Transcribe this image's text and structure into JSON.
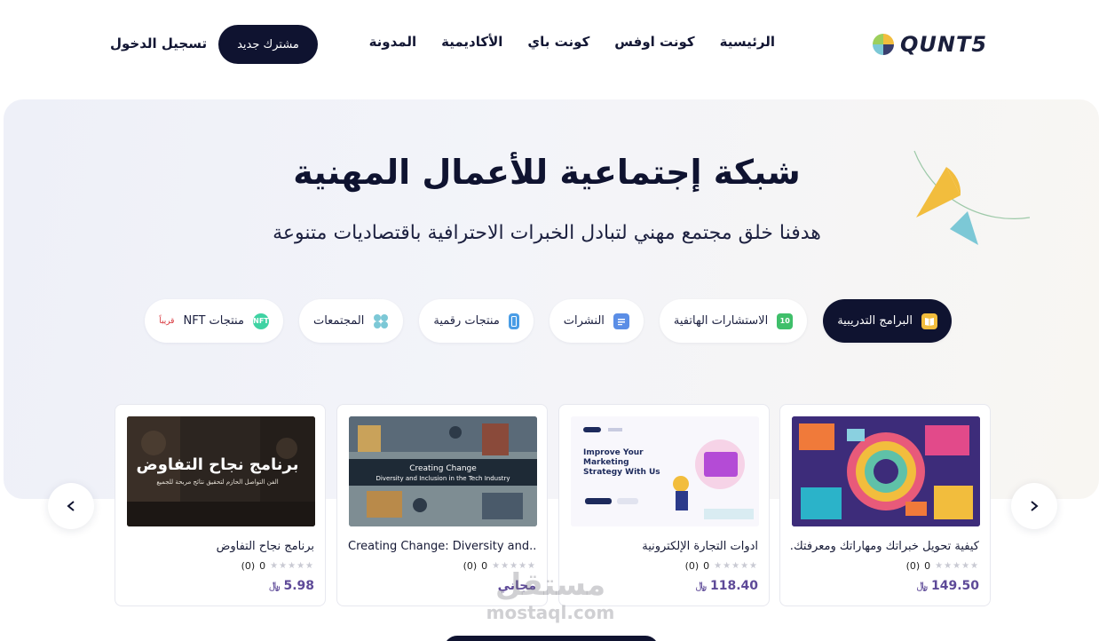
{
  "header": {
    "logo_text": "QUNT5",
    "nav": [
      "الرئيسية",
      "كونت اوفس",
      "كونت باي",
      "الأكاديمية",
      "المدونة"
    ],
    "register_button": "مشترك جديد",
    "login_link": "تسجيل الدخول"
  },
  "hero": {
    "title": "شبكة إجتماعية للأعمال المهنية",
    "subtitle": "هدفنا خلق مجتمع مهني لتبادل الخبرات الاحترافية باقتصاديات متنوعة"
  },
  "categories": [
    {
      "label": "البرامج التدريبية",
      "icon": "book-icon",
      "active": true
    },
    {
      "label": "الاستشارات الهاتفية",
      "icon": "calendar-icon",
      "active": false
    },
    {
      "label": "النشرات",
      "icon": "newsletter-icon",
      "active": false
    },
    {
      "label": "منتجات رقمية",
      "icon": "phone-icon",
      "active": false
    },
    {
      "label": "المجتمعات",
      "icon": "community-icon",
      "active": false
    },
    {
      "label": "منتجات NFT",
      "icon": "nft-icon",
      "active": false,
      "badge": "قريباً"
    }
  ],
  "nft_icon_text": "NFT",
  "calendar_icon_text": "10",
  "products": [
    {
      "title": "كيفية تحويل خبراتك ومهاراتك ومعرفتك...",
      "rating": "0",
      "reviews": "(0)",
      "price": "149.50",
      "currency": "﷼"
    },
    {
      "title": "ادوات التجارة الإلكترونية",
      "rating": "0",
      "reviews": "(0)",
      "price": "118.40",
      "currency": "﷼",
      "image_text": {
        "heading": "Improve Your Marketing Strategy With Us"
      }
    },
    {
      "title": "Creating Change: Diversity and...",
      "rating": "0",
      "reviews": "(0)",
      "price": "مجاني",
      "currency": "",
      "image_text": {
        "heading": "Creating Change",
        "sub": "Diversity and Inclusion in the Tech Industry"
      }
    },
    {
      "title": "برنامج نجاح التفاوض",
      "rating": "0",
      "reviews": "(0)",
      "price": "5.98",
      "currency": "﷼",
      "image_text": {
        "heading": "برنامج نجاح التفاوض",
        "sub": "الفن التواصل الحازم لتحقيق نتائج مربحة للجميع"
      }
    }
  ],
  "watermark": {
    "ar": "مستقل",
    "en": "mostaql.com"
  },
  "colors": {
    "primary": "#0f1330",
    "price": "#5e4a98",
    "accent_yellow": "#f2bd3d",
    "accent_teal": "#7cc8d6"
  }
}
